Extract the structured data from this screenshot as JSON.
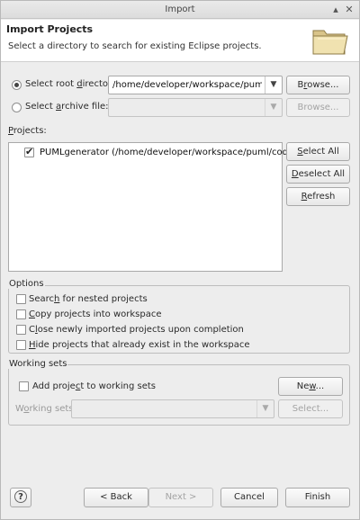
{
  "window": {
    "title": "Import",
    "minimize_glyph": "▴",
    "close_glyph": "✕"
  },
  "header": {
    "title": "Import Projects",
    "description": "Select a directory to search for existing Eclipse projects.",
    "icon": "folder-icon"
  },
  "source": {
    "root_dir_label_pre": "Select root ",
    "root_dir_label_u": "d",
    "root_dir_label_post": "irectory:",
    "root_dir_value": "/home/developer/workspace/puml/code",
    "root_selected": true,
    "archive_label_pre": "Select ",
    "archive_label_u": "a",
    "archive_label_post": "rchive file:",
    "archive_value": "",
    "browse_label_pre": "B",
    "browse_label_u": "r",
    "browse_label_post": "owse...",
    "archive_browse_label": "Browse..."
  },
  "projects": {
    "label_pre": "",
    "label_u": "P",
    "label_post": "rojects:",
    "items": [
      {
        "label": "PUMLgenerator (/home/developer/workspace/puml/code)",
        "checked": true
      }
    ],
    "select_all_pre": "",
    "select_all_u": "S",
    "select_all_post": "elect All",
    "deselect_all_pre": "",
    "deselect_all_u": "D",
    "deselect_all_post": "eselect All",
    "refresh_pre": "",
    "refresh_u": "R",
    "refresh_post": "efresh"
  },
  "options": {
    "title": "Options",
    "items": [
      {
        "pre": "Searc",
        "u": "h",
        "post": " for nested projects",
        "checked": false
      },
      {
        "pre": "",
        "u": "C",
        "post": "opy projects into workspace",
        "checked": false
      },
      {
        "pre": "C",
        "u": "l",
        "post": "ose newly imported projects upon completion",
        "checked": false
      },
      {
        "pre": "",
        "u": "H",
        "post": "ide projects that already exist in the workspace",
        "checked": false
      }
    ]
  },
  "working_sets": {
    "title": "Working sets",
    "add_pre": "Add proje",
    "add_u": "c",
    "add_post": "t to working sets",
    "add_checked": false,
    "new_pre": "Ne",
    "new_u": "w",
    "new_post": "...",
    "sets_label_pre": "W",
    "sets_label_u": "o",
    "sets_label_post": "rking sets:",
    "sets_value": "",
    "select_label": "Select..."
  },
  "footer": {
    "help_glyph": "?",
    "back_label": "< Back",
    "next_label": "Next >",
    "cancel_label": "Cancel",
    "finish_label": "Finish"
  }
}
